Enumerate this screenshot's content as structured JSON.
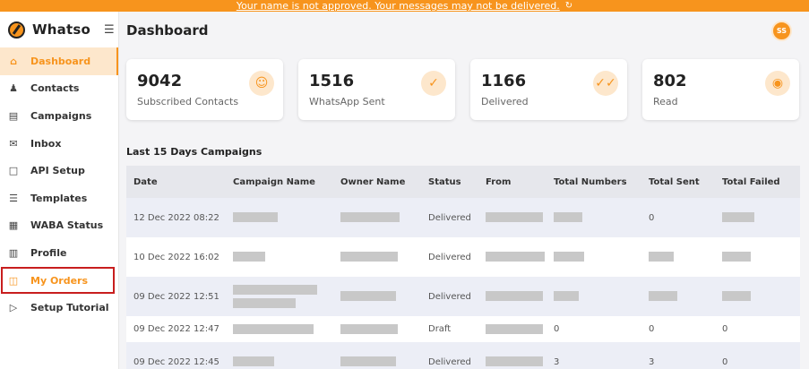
{
  "banner": {
    "text": "Your name is not approved. Your messages may not be delivered.",
    "icon": "refresh-icon"
  },
  "sidebar": {
    "brand": "Whatso",
    "items": [
      {
        "label": "Dashboard",
        "icon": "home-icon"
      },
      {
        "label": "Contacts",
        "icon": "users-icon"
      },
      {
        "label": "Campaigns",
        "icon": "campaign-icon"
      },
      {
        "label": "Inbox",
        "icon": "inbox-icon"
      },
      {
        "label": "API Setup",
        "icon": "api-icon"
      },
      {
        "label": "Templates",
        "icon": "template-icon"
      },
      {
        "label": "WABA Status",
        "icon": "status-icon"
      },
      {
        "label": "Profile",
        "icon": "profile-icon"
      },
      {
        "label": "My Orders",
        "icon": "cart-icon"
      },
      {
        "label": "Setup Tutorial",
        "icon": "play-icon"
      }
    ]
  },
  "header": {
    "title": "Dashboard",
    "avatar_initials": "SS"
  },
  "stats": [
    {
      "value": "9042",
      "label": "Subscribed Contacts",
      "icon": "user-icon"
    },
    {
      "value": "1516",
      "label": "WhatsApp Sent",
      "icon": "check-icon"
    },
    {
      "value": "1166",
      "label": "Delivered",
      "icon": "double-check-icon"
    },
    {
      "value": "802",
      "label": "Read",
      "icon": "eye-icon"
    }
  ],
  "campaigns": {
    "title": "Last 15 Days Campaigns",
    "columns": [
      "Date",
      "Campaign Name",
      "Owner Name",
      "Status",
      "From",
      "Total Numbers",
      "Total Sent",
      "Total Failed"
    ],
    "rows": [
      {
        "date": "12 Dec 2022 08:22",
        "status": "Delivered",
        "total_numbers": "",
        "total_sent": "0",
        "total_failed": ""
      },
      {
        "date": "10 Dec 2022 16:02",
        "status": "Delivered",
        "total_numbers": "",
        "total_sent": "",
        "total_failed": ""
      },
      {
        "date": "09 Dec 2022 12:51",
        "status": "Delivered",
        "total_numbers": "",
        "total_sent": "",
        "total_failed": ""
      },
      {
        "date": "09 Dec 2022 12:47",
        "status": "Draft",
        "total_numbers": "0",
        "total_sent": "0",
        "total_failed": "0"
      },
      {
        "date": "09 Dec 2022 12:45",
        "status": "Delivered",
        "total_numbers": "3",
        "total_sent": "3",
        "total_failed": "0"
      }
    ]
  }
}
